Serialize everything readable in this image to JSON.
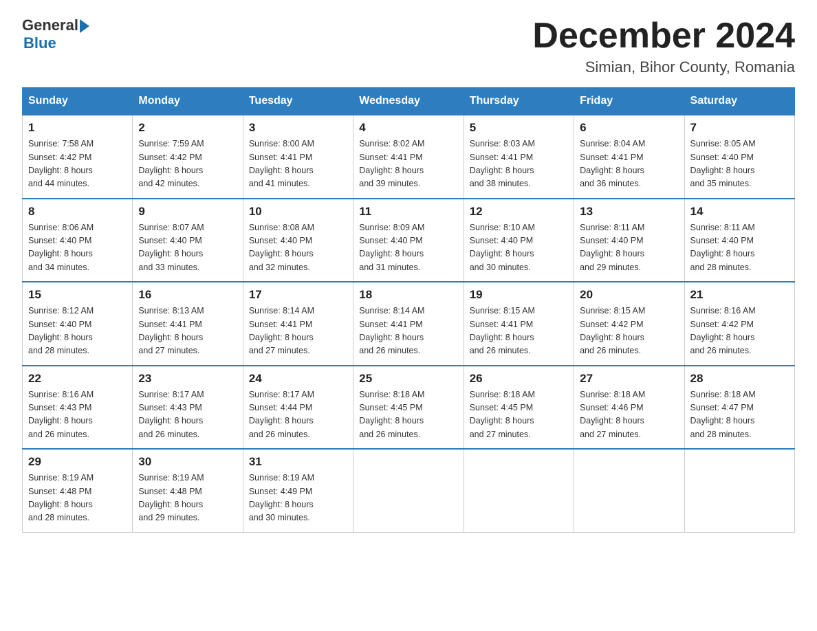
{
  "header": {
    "logo_general": "General",
    "logo_blue": "Blue",
    "title": "December 2024",
    "subtitle": "Simian, Bihor County, Romania"
  },
  "days_of_week": [
    "Sunday",
    "Monday",
    "Tuesday",
    "Wednesday",
    "Thursday",
    "Friday",
    "Saturday"
  ],
  "weeks": [
    [
      {
        "day": "1",
        "sunrise": "7:58 AM",
        "sunset": "4:42 PM",
        "daylight": "8 hours and 44 minutes."
      },
      {
        "day": "2",
        "sunrise": "7:59 AM",
        "sunset": "4:42 PM",
        "daylight": "8 hours and 42 minutes."
      },
      {
        "day": "3",
        "sunrise": "8:00 AM",
        "sunset": "4:41 PM",
        "daylight": "8 hours and 41 minutes."
      },
      {
        "day": "4",
        "sunrise": "8:02 AM",
        "sunset": "4:41 PM",
        "daylight": "8 hours and 39 minutes."
      },
      {
        "day": "5",
        "sunrise": "8:03 AM",
        "sunset": "4:41 PM",
        "daylight": "8 hours and 38 minutes."
      },
      {
        "day": "6",
        "sunrise": "8:04 AM",
        "sunset": "4:41 PM",
        "daylight": "8 hours and 36 minutes."
      },
      {
        "day": "7",
        "sunrise": "8:05 AM",
        "sunset": "4:40 PM",
        "daylight": "8 hours and 35 minutes."
      }
    ],
    [
      {
        "day": "8",
        "sunrise": "8:06 AM",
        "sunset": "4:40 PM",
        "daylight": "8 hours and 34 minutes."
      },
      {
        "day": "9",
        "sunrise": "8:07 AM",
        "sunset": "4:40 PM",
        "daylight": "8 hours and 33 minutes."
      },
      {
        "day": "10",
        "sunrise": "8:08 AM",
        "sunset": "4:40 PM",
        "daylight": "8 hours and 32 minutes."
      },
      {
        "day": "11",
        "sunrise": "8:09 AM",
        "sunset": "4:40 PM",
        "daylight": "8 hours and 31 minutes."
      },
      {
        "day": "12",
        "sunrise": "8:10 AM",
        "sunset": "4:40 PM",
        "daylight": "8 hours and 30 minutes."
      },
      {
        "day": "13",
        "sunrise": "8:11 AM",
        "sunset": "4:40 PM",
        "daylight": "8 hours and 29 minutes."
      },
      {
        "day": "14",
        "sunrise": "8:11 AM",
        "sunset": "4:40 PM",
        "daylight": "8 hours and 28 minutes."
      }
    ],
    [
      {
        "day": "15",
        "sunrise": "8:12 AM",
        "sunset": "4:40 PM",
        "daylight": "8 hours and 28 minutes."
      },
      {
        "day": "16",
        "sunrise": "8:13 AM",
        "sunset": "4:41 PM",
        "daylight": "8 hours and 27 minutes."
      },
      {
        "day": "17",
        "sunrise": "8:14 AM",
        "sunset": "4:41 PM",
        "daylight": "8 hours and 27 minutes."
      },
      {
        "day": "18",
        "sunrise": "8:14 AM",
        "sunset": "4:41 PM",
        "daylight": "8 hours and 26 minutes."
      },
      {
        "day": "19",
        "sunrise": "8:15 AM",
        "sunset": "4:41 PM",
        "daylight": "8 hours and 26 minutes."
      },
      {
        "day": "20",
        "sunrise": "8:15 AM",
        "sunset": "4:42 PM",
        "daylight": "8 hours and 26 minutes."
      },
      {
        "day": "21",
        "sunrise": "8:16 AM",
        "sunset": "4:42 PM",
        "daylight": "8 hours and 26 minutes."
      }
    ],
    [
      {
        "day": "22",
        "sunrise": "8:16 AM",
        "sunset": "4:43 PM",
        "daylight": "8 hours and 26 minutes."
      },
      {
        "day": "23",
        "sunrise": "8:17 AM",
        "sunset": "4:43 PM",
        "daylight": "8 hours and 26 minutes."
      },
      {
        "day": "24",
        "sunrise": "8:17 AM",
        "sunset": "4:44 PM",
        "daylight": "8 hours and 26 minutes."
      },
      {
        "day": "25",
        "sunrise": "8:18 AM",
        "sunset": "4:45 PM",
        "daylight": "8 hours and 26 minutes."
      },
      {
        "day": "26",
        "sunrise": "8:18 AM",
        "sunset": "4:45 PM",
        "daylight": "8 hours and 27 minutes."
      },
      {
        "day": "27",
        "sunrise": "8:18 AM",
        "sunset": "4:46 PM",
        "daylight": "8 hours and 27 minutes."
      },
      {
        "day": "28",
        "sunrise": "8:18 AM",
        "sunset": "4:47 PM",
        "daylight": "8 hours and 28 minutes."
      }
    ],
    [
      {
        "day": "29",
        "sunrise": "8:19 AM",
        "sunset": "4:48 PM",
        "daylight": "8 hours and 28 minutes."
      },
      {
        "day": "30",
        "sunrise": "8:19 AM",
        "sunset": "4:48 PM",
        "daylight": "8 hours and 29 minutes."
      },
      {
        "day": "31",
        "sunrise": "8:19 AM",
        "sunset": "4:49 PM",
        "daylight": "8 hours and 30 minutes."
      },
      null,
      null,
      null,
      null
    ]
  ],
  "labels": {
    "sunrise": "Sunrise:",
    "sunset": "Sunset:",
    "daylight": "Daylight:"
  }
}
